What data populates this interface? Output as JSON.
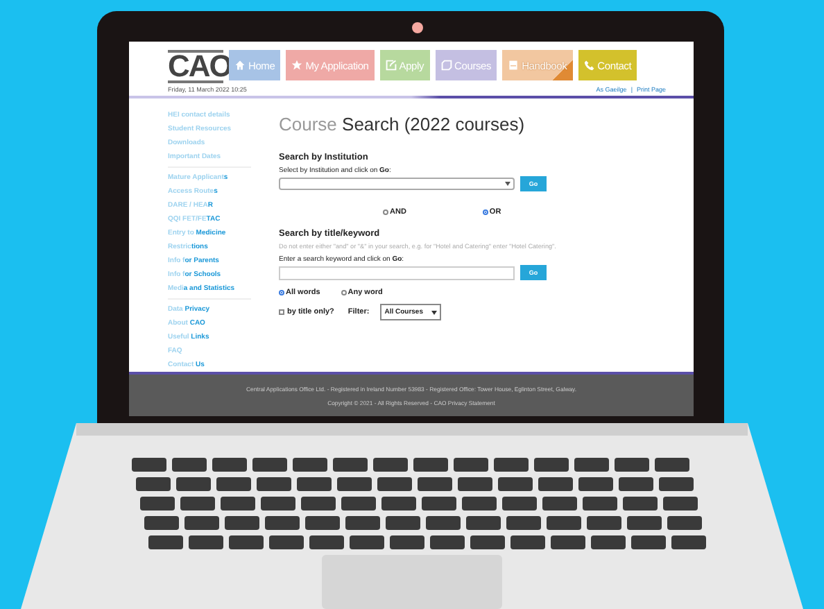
{
  "logo": "CAO",
  "date": "Friday, 11 March 2022 10:25",
  "nav": [
    {
      "label": "Home",
      "kind": "home",
      "color": "#a7c3e6"
    },
    {
      "label": "My Application",
      "kind": "star",
      "color": "#efa9a6"
    },
    {
      "label": "Apply",
      "kind": "edit",
      "color": "#b7d99e"
    },
    {
      "label": "Courses",
      "kind": "book",
      "color": "#c4bfe2"
    },
    {
      "label": "Handbook",
      "kind": "handbook",
      "color": "#f2c7a0"
    },
    {
      "label": "Contact",
      "kind": "phone",
      "color": "#d3c12c"
    }
  ],
  "top_links": {
    "language": "As Gaeilge",
    "separator": "|",
    "print": "Print Page"
  },
  "sidebar": [
    {
      "items": [
        "HEI contact details",
        "Student Resources",
        "Downloads",
        "Important Dates"
      ]
    },
    {
      "items": [
        "Mature Applicant**s**",
        "Access Route**s**",
        "DARE / HEA**R**",
        "QQI FET/FE**TAC**",
        "Entry to **Medicine**",
        "Restric**tions**",
        "Info f**or Parents**",
        "Info f**or Schools**",
        "Medi**a and Statistics**"
      ]
    },
    {
      "items": [
        "Data **Privacy**",
        "About **CAO**",
        "Useful **Links**",
        "FAQ",
        "Contact **Us**"
      ]
    }
  ],
  "title": {
    "light": "Course",
    "rest": " Search (2022 courses)"
  },
  "institution": {
    "heading": "Search by Institution",
    "label": "Select by Institution and click on **Go**:",
    "button": "Go"
  },
  "operators": [
    {
      "label": "AND",
      "selected": false
    },
    {
      "label": "OR",
      "selected": true
    }
  ],
  "keyword": {
    "heading": "Search by title/keyword",
    "hint": "Do not enter either \"and\" or \"&\" in your search, e.g. for \"Hotel and Catering\" enter \"Hotel Catering\".",
    "label": "Enter a search keyword and click on **Go**:",
    "button": "Go"
  },
  "match": [
    {
      "label": "All words",
      "selected": true
    },
    {
      "label": "Any word",
      "selected": false
    }
  ],
  "title_only": {
    "label": "by title only?",
    "checked": false
  },
  "filter": {
    "label": "Filter:",
    "value": "All Courses"
  },
  "footer": [
    "Central Applications Office Ltd. - Registered in Ireland Number 53983 - Registered Office: Tower House, Eglinton Street, Galway.",
    "Copyright © 2021 - All Rights Reserved - CAO Privacy Statement"
  ]
}
